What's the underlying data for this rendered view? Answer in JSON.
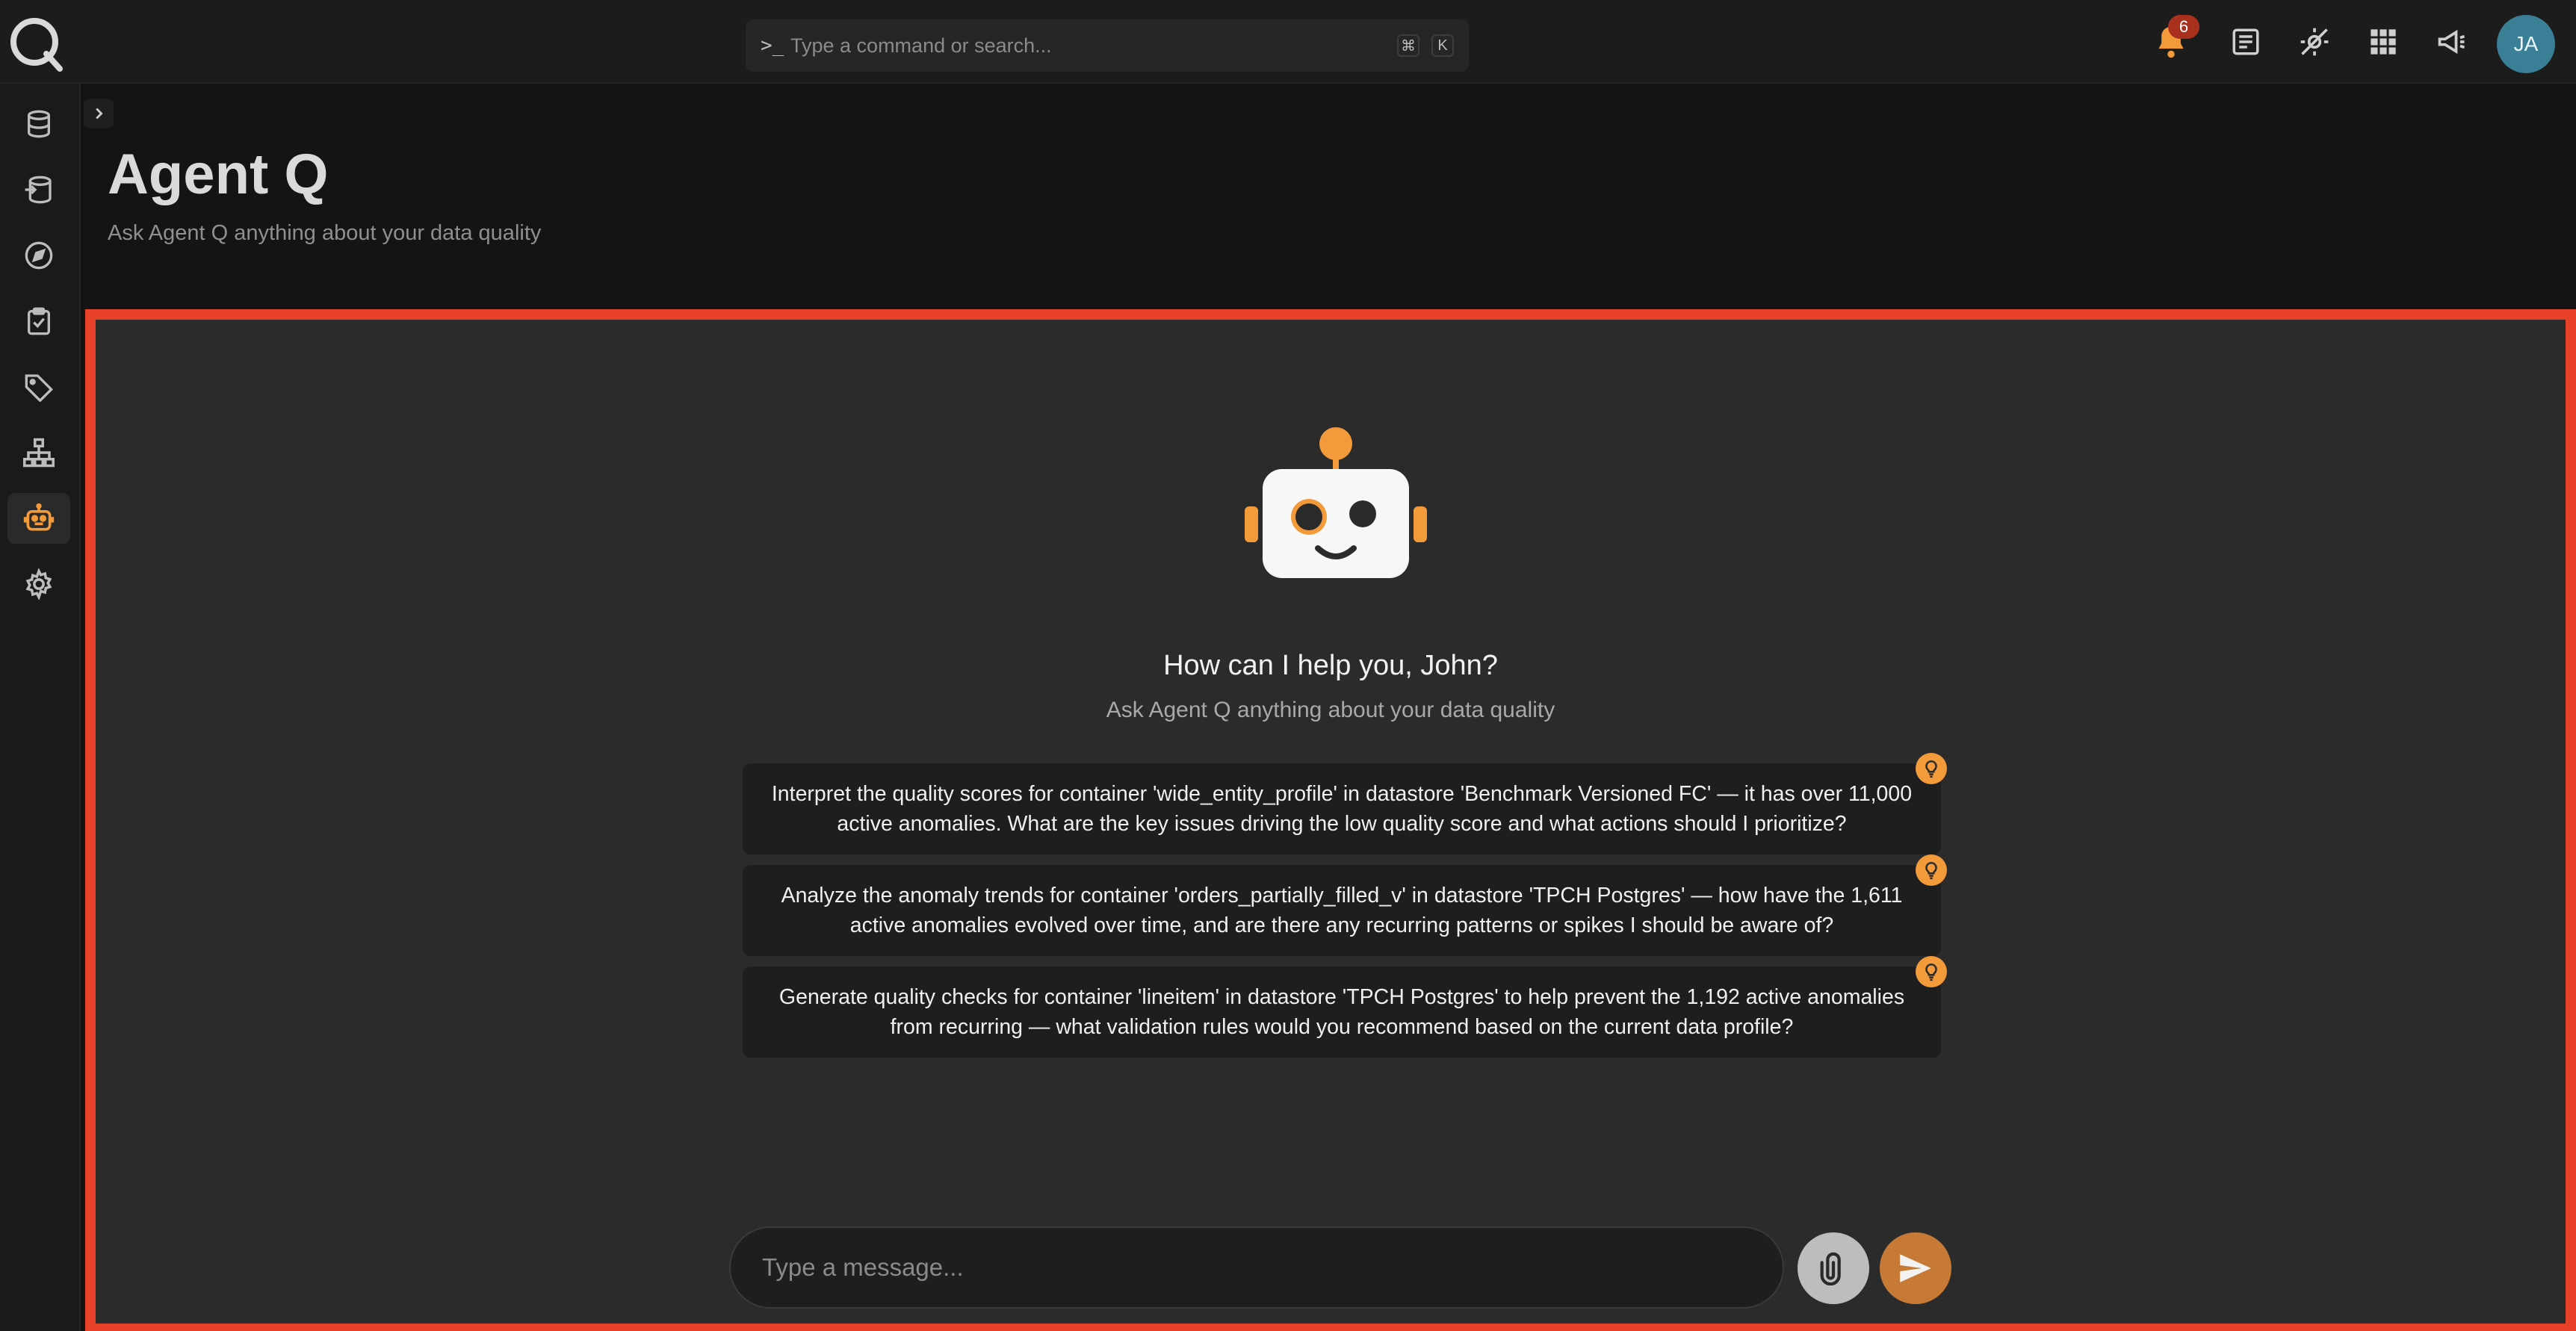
{
  "topbar": {
    "search_placeholder": "Type a command or search...",
    "search_prompt": ">_",
    "shortcut_keys": [
      "⌘",
      "K"
    ],
    "notifications_count": "6",
    "avatar_initials": "JA"
  },
  "header": {
    "title": "Agent Q",
    "subtitle": "Ask Agent Q anything about your data quality"
  },
  "chat": {
    "greeting": "How can I help you, John?",
    "greeting_sub": "Ask Agent Q anything about your data quality",
    "suggestions": [
      "Interpret the quality scores for container 'wide_entity_profile' in datastore 'Benchmark Versioned FC' — it has over 11,000 active anomalies. What are the key issues driving the low quality score and what actions should I prioritize?",
      "Analyze the anomaly trends for container 'orders_partially_filled_v' in datastore 'TPCH Postgres' — how have the 1,611 active anomalies evolved over time, and are there any recurring patterns or spikes I should be aware of?",
      "Generate quality checks for container 'lineitem' in datastore 'TPCH Postgres' to help prevent the 1,192 active anomalies from recurring — what validation rules would you recommend based on the current data profile?"
    ],
    "message_placeholder": "Type a message..."
  },
  "colors": {
    "accent": "#f39a3b",
    "highlight_border": "#e8412a",
    "badge": "#a8301d",
    "avatar": "#3a7f96"
  }
}
